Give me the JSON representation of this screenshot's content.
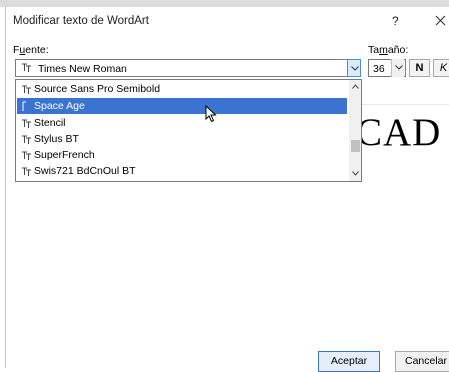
{
  "dialog": {
    "title": "Modificar texto de WordArt",
    "help": "?",
    "close": "✕"
  },
  "font": {
    "label_mnemonic": "u",
    "label_pre": "F",
    "label_post": "ente:",
    "value": "Times New Roman",
    "list": [
      {
        "label": "Source Sans Pro Semibold",
        "selected": false
      },
      {
        "label": "Space Age",
        "selected": true
      },
      {
        "label": "Stencil",
        "selected": false
      },
      {
        "label": "Stylus BT",
        "selected": false
      },
      {
        "label": "SuperFrench",
        "selected": false
      },
      {
        "label": "Swis721 BdCnOul BT",
        "selected": false
      }
    ]
  },
  "size": {
    "label_pre": "Ta",
    "label_mnemonic": "m",
    "label_post": "año:",
    "value": "36"
  },
  "format": {
    "bold": "N",
    "italic": "K"
  },
  "preview": {
    "text": "CAD"
  },
  "buttons": {
    "accept": "Aceptar",
    "cancel": "Cancelar"
  },
  "colors": {
    "selection": "#3a74d0",
    "accent_border": "#4a90d9"
  }
}
